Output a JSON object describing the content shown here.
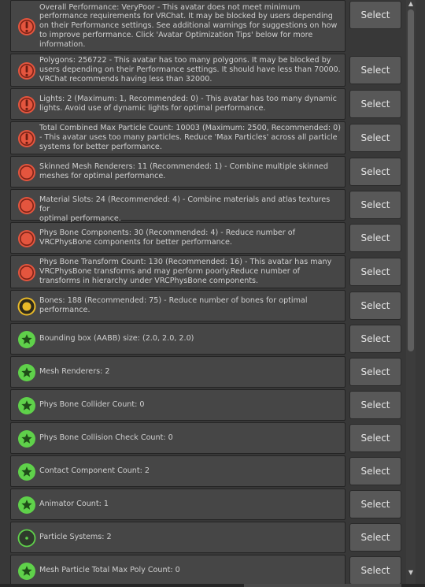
{
  "button_label": "Select",
  "colors": {
    "error": "#e4553e",
    "warning": "#e8b928",
    "good": "#5fd14a"
  },
  "items": [
    {
      "status": "error-exclamation",
      "icon": "exclamation-circle-icon",
      "text": "Overall Performance: VeryPoor - This avatar does not meet minimum\nperformance requirements for VRChat. It may be blocked by users depending\non their Performance settings. See additional warnings for suggestions on how\nto improve performance. Click 'Avatar Optimization Tips' below for more\ninformation."
    },
    {
      "status": "error-exclamation",
      "icon": "exclamation-circle-icon",
      "text": "Polygons: 256722 - This avatar has too many polygons. It may be blocked by\nusers depending on their Performance settings. It should have less than 70000.\nVRChat recommends having less than 32000."
    },
    {
      "status": "error-exclamation",
      "icon": "exclamation-circle-icon",
      "text": "Lights: 2 (Maximum: 1, Recommended: 0) - This avatar has too many dynamic\nlights. Avoid use of dynamic lights for optimal performance."
    },
    {
      "status": "error-exclamation",
      "icon": "exclamation-circle-icon",
      "text": "Total Combined Max Particle Count: 10003 (Maximum: 2500, Recommended: 0)\n- This avatar uses too many particles. Reduce 'Max Particles' across all particle\nsystems for better performance."
    },
    {
      "status": "error-dot",
      "icon": "red-circle-icon",
      "text": "Skinned Mesh Renderers: 11 (Recommended: 1) - Combine multiple skinned\nmeshes for optimal performance."
    },
    {
      "status": "error-dot",
      "icon": "red-circle-icon",
      "text": "Material Slots: 24 (Recommended: 4) - Combine materials and atlas textures for\noptimal performance."
    },
    {
      "status": "error-dot",
      "icon": "red-circle-icon",
      "text": "Phys Bone Components: 30 (Recommended: 4) - Reduce number of\nVRCPhysBone components for better performance."
    },
    {
      "status": "error-dot",
      "icon": "red-circle-icon",
      "text": "Phys Bone Transform Count: 130 (Recommended: 16) - This avatar has many\nVRCPhysBone transforms and may perform poorly.Reduce number of\ntransforms in hierarchy under VRCPhysBone components."
    },
    {
      "status": "warning",
      "icon": "yellow-ring-icon",
      "text": "Bones: 188 (Recommended: 75) - Reduce number of bones for optimal\nperformance."
    },
    {
      "status": "good",
      "icon": "green-star-icon",
      "text": "Bounding box (AABB) size: (2.0, 2.0, 2.0)"
    },
    {
      "status": "good",
      "icon": "green-star-icon",
      "text": "Mesh Renderers: 2"
    },
    {
      "status": "good",
      "icon": "green-star-icon",
      "text": "Phys Bone Collider Count: 0"
    },
    {
      "status": "good",
      "icon": "green-star-icon",
      "text": "Phys Bone Collision Check Count: 0"
    },
    {
      "status": "good",
      "icon": "green-star-icon",
      "text": "Contact Component Count: 2"
    },
    {
      "status": "good",
      "icon": "green-star-icon",
      "text": "Animator Count: 1"
    },
    {
      "status": "good-ring",
      "icon": "green-ring-icon",
      "text": "Particle Systems: 2"
    },
    {
      "status": "good",
      "icon": "green-star-icon",
      "text": "Mesh Particle Total Max Poly Count: 0"
    }
  ]
}
